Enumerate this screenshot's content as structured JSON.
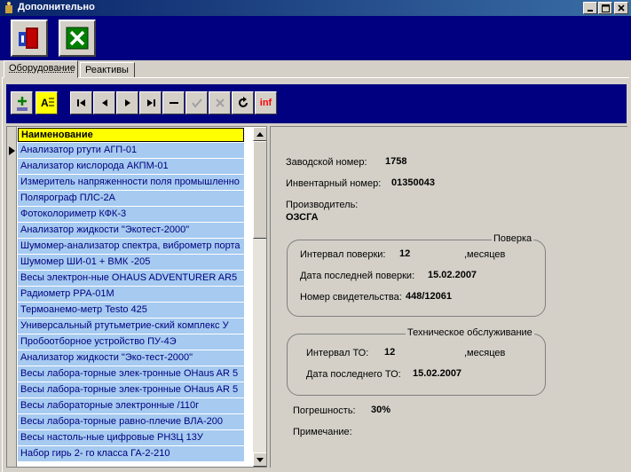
{
  "window": {
    "title": "Дополнительно",
    "caption_buttons": [
      "minimize",
      "maximize",
      "close"
    ]
  },
  "main_toolbar": {
    "buttons": [
      {
        "name": "exit",
        "icon": "exit-door-icon"
      },
      {
        "name": "cancel",
        "icon": "cancel-x-icon"
      }
    ]
  },
  "tabs": [
    {
      "label": "Оборудование",
      "active": true
    },
    {
      "label": "Реактивы",
      "active": false
    }
  ],
  "navigator": {
    "buttons": [
      {
        "name": "add",
        "icon": "add-record-icon",
        "label": "+"
      },
      {
        "name": "filter",
        "icon": "filter-icon",
        "label": "A"
      },
      {
        "name": "first",
        "icon": "first-record-icon",
        "label": "|◄"
      },
      {
        "name": "prior",
        "icon": "prior-record-icon",
        "label": "◄"
      },
      {
        "name": "next",
        "icon": "next-record-icon",
        "label": "►"
      },
      {
        "name": "last",
        "icon": "last-record-icon",
        "label": "►|"
      },
      {
        "name": "delete",
        "icon": "delete-record-icon",
        "label": "—"
      },
      {
        "name": "post",
        "icon": "post-check-icon",
        "label": "✓"
      },
      {
        "name": "cancel-edit",
        "icon": "cancel-edit-icon",
        "label": "✕"
      },
      {
        "name": "refresh",
        "icon": "refresh-icon",
        "label": "↻"
      },
      {
        "name": "info",
        "icon": "info-icon",
        "label": "inf"
      }
    ]
  },
  "grid": {
    "header": "Наименование",
    "rows": [
      "Анализатор ртути АГП-01",
      "Анализатор кислорода АКПМ-01",
      "Измеритель напряженности поля промышленно",
      "Полярограф ПЛС-2А",
      "Фотоколориметр КФК-3",
      "Анализатор жидкости \"Экотест-2000\"",
      "Шумомер-анализатор спектра, виброметр порта",
      "Шумомер ШИ-01 + ВМК -205",
      "Весы электрон-ные OHAUS ADVENTURER AR5",
      "Радиометр РРА-01М",
      "Термоанемо-метр Testo 425",
      "Универсальный ртутьметрие-ский комплекс У",
      "Пробоотборное устройство ПУ-4Э",
      "Анализатор жидкости \"Эко-тест-2000\"",
      "Весы лабора-торные элек-тронные OHaus AR 5",
      "Весы лабора-торные элек-тронные OHaus AR 5",
      "Весы лабораторные электронные /110г",
      "Весы лабора-торные равно-плечие ВЛА-200",
      "Весы настоль-ные цифровые РН3Ц 13У",
      "Набор гирь  2- го класса ГА-2-210"
    ],
    "current_row": 0
  },
  "details": {
    "serial_label": "Заводской номер:",
    "serial_value": "1758",
    "inventory_label": "Инвентарный номер:",
    "inventory_value": "01350043",
    "manufacturer_label": "Производитель:",
    "manufacturer_value": "ОЗСГА",
    "verification": {
      "title": "Поверка",
      "interval_label": "Интервал поверки:",
      "interval_value": "12",
      "interval_unit": ",месяцев",
      "last_date_label": "Дата последней поверки:",
      "last_date_value": "15.02.2007",
      "cert_label": "Номер свидетельства:",
      "cert_value": "448/12061"
    },
    "maintenance": {
      "title": "Техническое обслуживание",
      "interval_label": "Интервал ТО:",
      "interval_value": "12",
      "interval_unit": ",месяцев",
      "last_date_label": "Дата последнего ТО:",
      "last_date_value": "15.02.2007"
    },
    "error_label": "Погрешность:",
    "error_value": "30%",
    "note_label": "Примечание:"
  }
}
